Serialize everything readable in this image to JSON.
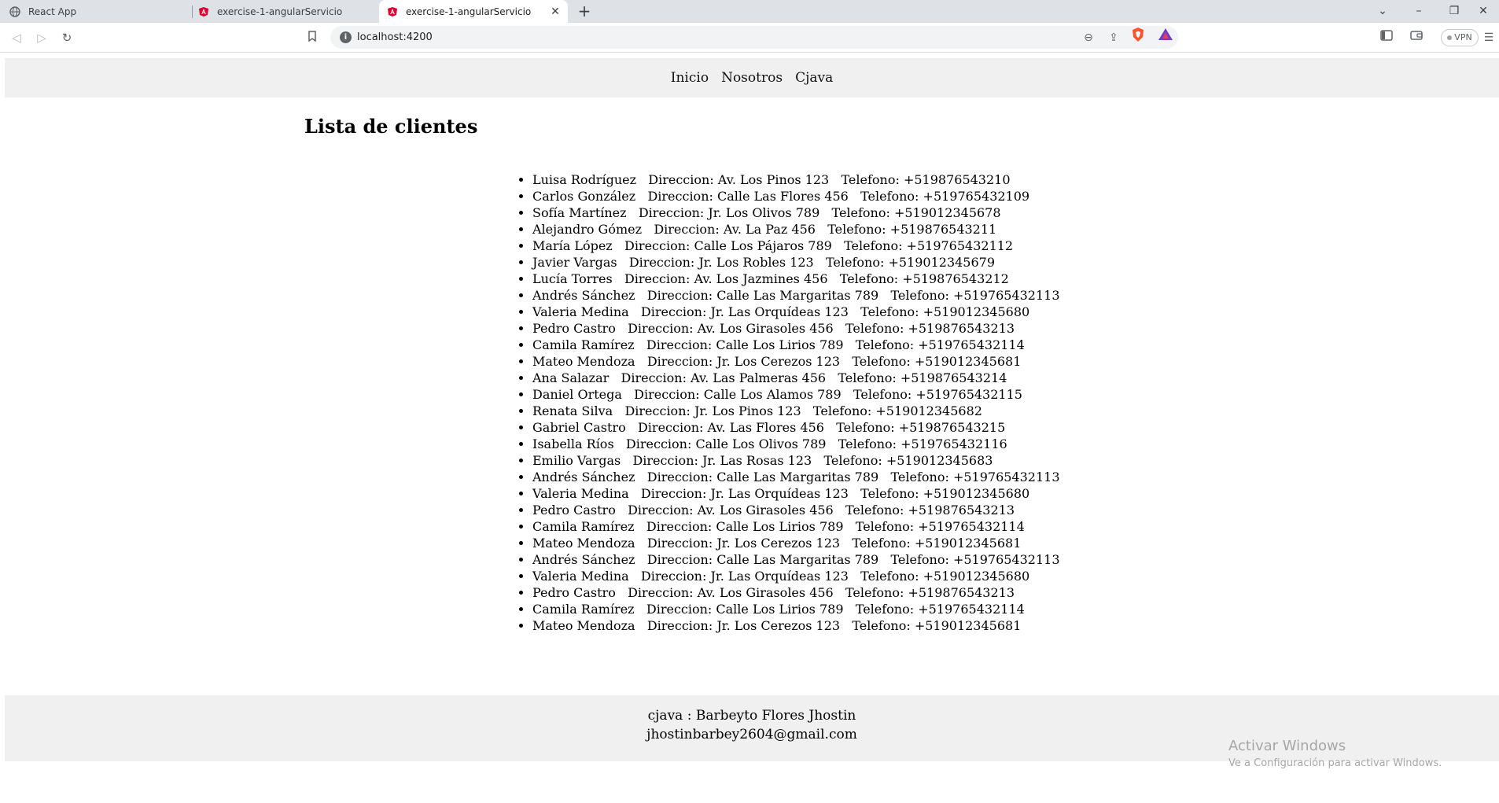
{
  "browser": {
    "tabs": [
      {
        "title": "React App"
      },
      {
        "title": "exercise-1-angularServicio"
      },
      {
        "title": "exercise-1-angularServicio"
      }
    ],
    "address": "localhost:4200",
    "vpn_label": "VPN"
  },
  "app": {
    "nav": [
      "Inicio",
      "Nosotros",
      "Cjava"
    ],
    "title": "Lista de clientes",
    "clients": [
      {
        "name": "Luisa Rodríguez",
        "direccion": "Direccion: Av. Los Pinos 123",
        "telefono": "Telefono: +519876543210"
      },
      {
        "name": "Carlos González",
        "direccion": "Direccion: Calle Las Flores 456",
        "telefono": "Telefono: +519765432109"
      },
      {
        "name": "Sofía Martínez",
        "direccion": "Direccion: Jr. Los Olivos 789",
        "telefono": "Telefono: +519012345678"
      },
      {
        "name": "Alejandro Gómez",
        "direccion": "Direccion: Av. La Paz 456",
        "telefono": "Telefono: +519876543211"
      },
      {
        "name": "María López",
        "direccion": "Direccion: Calle Los Pájaros 789",
        "telefono": "Telefono: +519765432112"
      },
      {
        "name": "Javier Vargas",
        "direccion": "Direccion: Jr. Los Robles 123",
        "telefono": "Telefono: +519012345679"
      },
      {
        "name": "Lucía Torres",
        "direccion": "Direccion: Av. Los Jazmines 456",
        "telefono": "Telefono: +519876543212"
      },
      {
        "name": "Andrés Sánchez",
        "direccion": "Direccion: Calle Las Margaritas 789",
        "telefono": "Telefono: +519765432113"
      },
      {
        "name": "Valeria Medina",
        "direccion": "Direccion: Jr. Las Orquídeas 123",
        "telefono": "Telefono: +519012345680"
      },
      {
        "name": "Pedro Castro",
        "direccion": "Direccion: Av. Los Girasoles 456",
        "telefono": "Telefono: +519876543213"
      },
      {
        "name": "Camila Ramírez",
        "direccion": "Direccion: Calle Los Lirios 789",
        "telefono": "Telefono: +519765432114"
      },
      {
        "name": "Mateo Mendoza",
        "direccion": "Direccion: Jr. Los Cerezos 123",
        "telefono": "Telefono: +519012345681"
      },
      {
        "name": "Ana Salazar",
        "direccion": "Direccion: Av. Las Palmeras 456",
        "telefono": "Telefono: +519876543214"
      },
      {
        "name": "Daniel Ortega",
        "direccion": "Direccion: Calle Los Alamos 789",
        "telefono": "Telefono: +519765432115"
      },
      {
        "name": "Renata Silva",
        "direccion": "Direccion: Jr. Los Pinos 123",
        "telefono": "Telefono: +519012345682"
      },
      {
        "name": "Gabriel Castro",
        "direccion": "Direccion: Av. Las Flores 456",
        "telefono": "Telefono: +519876543215"
      },
      {
        "name": "Isabella Ríos",
        "direccion": "Direccion: Calle Los Olivos 789",
        "telefono": "Telefono: +519765432116"
      },
      {
        "name": "Emilio Vargas",
        "direccion": "Direccion: Jr. Las Rosas 123",
        "telefono": "Telefono: +519012345683"
      },
      {
        "name": "Andrés Sánchez",
        "direccion": "Direccion: Calle Las Margaritas 789",
        "telefono": "Telefono: +519765432113"
      },
      {
        "name": "Valeria Medina",
        "direccion": "Direccion: Jr. Las Orquídeas 123",
        "telefono": "Telefono: +519012345680"
      },
      {
        "name": "Pedro Castro",
        "direccion": "Direccion: Av. Los Girasoles 456",
        "telefono": "Telefono: +519876543213"
      },
      {
        "name": "Camila Ramírez",
        "direccion": "Direccion: Calle Los Lirios 789",
        "telefono": "Telefono: +519765432114"
      },
      {
        "name": "Mateo Mendoza",
        "direccion": "Direccion: Jr. Los Cerezos 123",
        "telefono": "Telefono: +519012345681"
      },
      {
        "name": "Andrés Sánchez",
        "direccion": "Direccion: Calle Las Margaritas 789",
        "telefono": "Telefono: +519765432113"
      },
      {
        "name": "Valeria Medina",
        "direccion": "Direccion: Jr. Las Orquídeas 123",
        "telefono": "Telefono: +519012345680"
      },
      {
        "name": "Pedro Castro",
        "direccion": "Direccion: Av. Los Girasoles 456",
        "telefono": "Telefono: +519876543213"
      },
      {
        "name": "Camila Ramírez",
        "direccion": "Direccion: Calle Los Lirios 789",
        "telefono": "Telefono: +519765432114"
      },
      {
        "name": "Mateo Mendoza",
        "direccion": "Direccion: Jr. Los Cerezos 123",
        "telefono": "Telefono: +519012345681"
      }
    ],
    "footer": {
      "line1": "cjava : Barbeyto Flores Jhostin",
      "line2": "jhostinbarbey2604@gmail.com"
    }
  },
  "os_watermark": {
    "title": "Activar Windows",
    "subtitle": "Ve a Configuración para activar Windows."
  },
  "icons": {
    "back": "arrow-left-icon",
    "forward": "arrow-right-icon",
    "reload": "reload-icon",
    "bookmark": "bookmark-icon",
    "zoom": "zoom-out-icon",
    "share": "share-icon",
    "brave": "brave-shield-icon",
    "rewards": "brave-rewards-icon",
    "sidebar": "sidebar-icon",
    "wallet": "wallet-icon",
    "menu": "menu-icon"
  },
  "colors": {
    "header_bg": "#f0f0f0",
    "footer_bg": "#f0f0f0",
    "tabstrip_bg": "#dee1e6",
    "brave_orange": "#fb542b"
  }
}
